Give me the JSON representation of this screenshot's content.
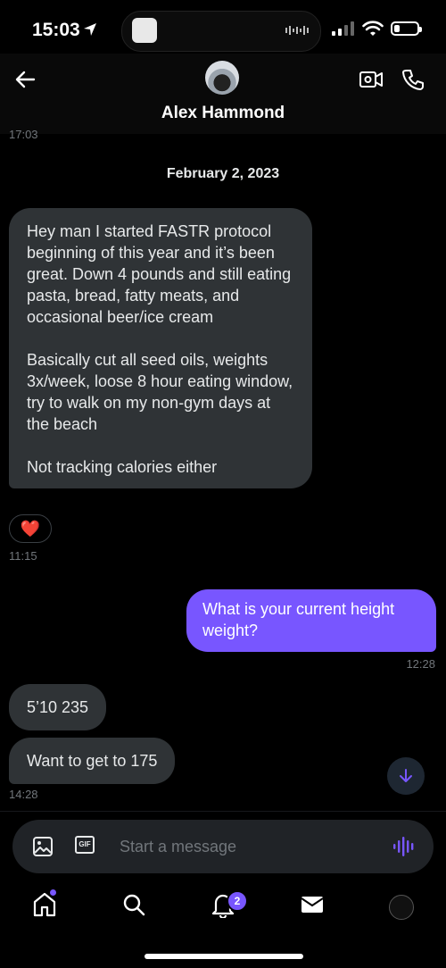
{
  "status_bar": {
    "time": "15:03"
  },
  "header": {
    "contact_name": "Alex Hammond",
    "clipped_time": "17:03"
  },
  "conversation": {
    "date_separator": "February 2, 2023",
    "messages": [
      {
        "direction": "incoming",
        "paragraphs": [
          "Hey man I started FASTR protocol beginning of this year and it’s been great. Down 4 pounds and still eating pasta, bread, fatty meats, and occasional beer/ice cream",
          "Basically cut all seed oils, weights 3x/week, loose 8 hour eating window, try to walk on my non-gym days at the beach",
          "Not tracking calories either"
        ],
        "reaction": "❤️",
        "time": "11:15"
      },
      {
        "direction": "outgoing",
        "text": "What is your current height weight?",
        "time": "12:28"
      },
      {
        "direction": "incoming",
        "text": "5’10 235"
      },
      {
        "direction": "incoming",
        "text": "Want to get to 175",
        "time": "14:28"
      }
    ]
  },
  "composer": {
    "placeholder": "Start a message",
    "gif_label": "GIF"
  },
  "tab_bar": {
    "notification_count": "2"
  },
  "colors": {
    "accent": "#7856ff",
    "incoming_bubble": "#2f3336",
    "background": "#000000"
  }
}
